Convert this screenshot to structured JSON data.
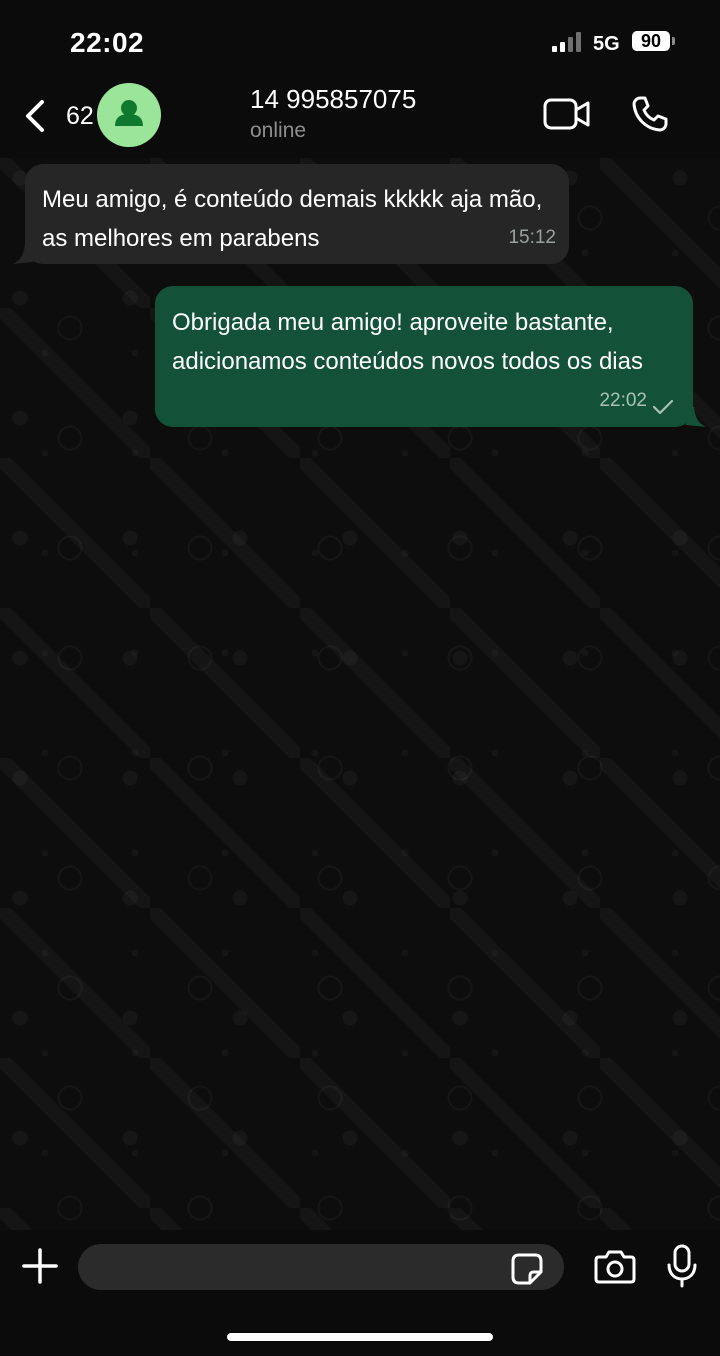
{
  "status_bar": {
    "time": "22:02",
    "network": "5G",
    "battery": "90"
  },
  "header": {
    "unread_count": "62",
    "contact_name": "14 995857075",
    "contact_status": "online"
  },
  "messages": [
    {
      "direction": "incoming",
      "text": "Meu amigo, é conteúdo demais kkkkk aja mão, as melhores em parabens",
      "time": "15:12"
    },
    {
      "direction": "outgoing",
      "text": "Obrigada meu amigo! aproveite bastante, adicionamos conteúdos novos todos os dias",
      "time": "22:02",
      "status_icon": "single-check-icon"
    }
  ],
  "composer": {
    "input_value": ""
  },
  "icons": {
    "back": "chevron-left-icon",
    "avatar": "person-icon",
    "video": "video-camera-icon",
    "voice": "phone-icon",
    "add": "plus-icon",
    "sticker": "sticker-icon",
    "camera": "camera-icon",
    "mic": "microphone-icon"
  },
  "colors": {
    "background": "#0b0b0b",
    "incoming_bubble": "#262626",
    "outgoing_bubble": "#135239",
    "avatar_background": "#9be59a",
    "avatar_icon": "#0f7a2e"
  }
}
